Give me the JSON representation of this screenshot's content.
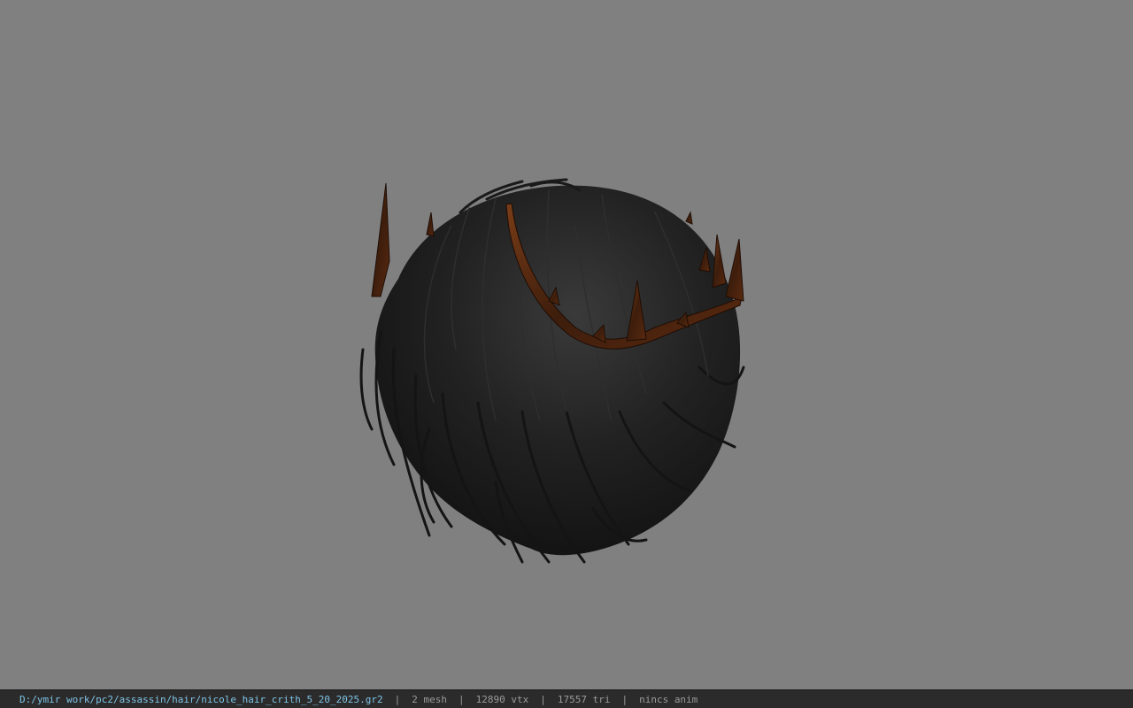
{
  "viewport": {
    "background": "#808080",
    "model_icon": "hair-mesh-preview"
  },
  "statusbar": {
    "file_path": "D:/ymir work/pc2/assassin/hair/nicole_hair_crith_5_20_2025.gr2",
    "separator": "|",
    "mesh_count": "2 mesh",
    "vertex_count": "12890 vtx",
    "triangle_count": "17557 tri",
    "anim_status": "nincs anim"
  },
  "colors": {
    "path_text": "#7ec3e6",
    "stat_text": "#9a9a9a",
    "statusbar_bg": "#2b2b2b",
    "hair": "#1c1c1c",
    "crown": "#4a2410"
  }
}
